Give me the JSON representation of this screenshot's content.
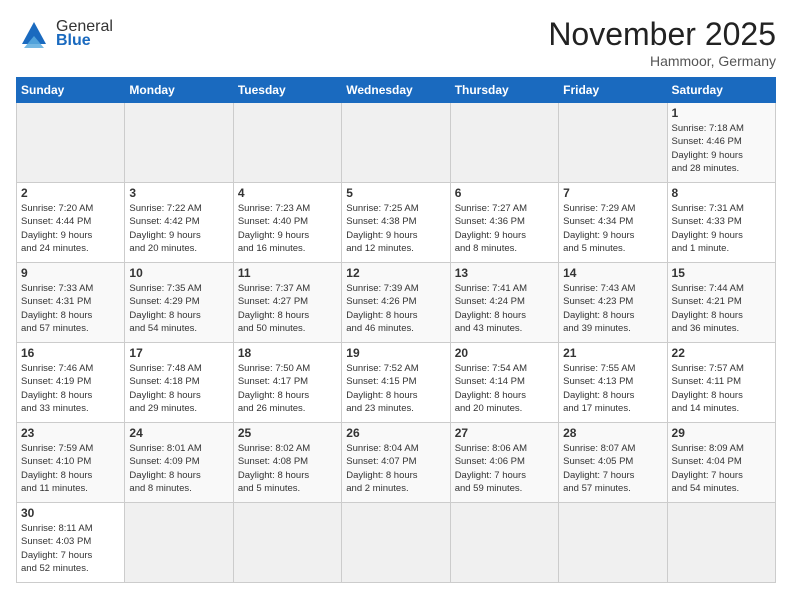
{
  "logo": {
    "general": "General",
    "blue": "Blue"
  },
  "header": {
    "title": "November 2025",
    "location": "Hammoor, Germany"
  },
  "weekdays": [
    "Sunday",
    "Monday",
    "Tuesday",
    "Wednesday",
    "Thursday",
    "Friday",
    "Saturday"
  ],
  "weeks": [
    [
      {
        "day": "",
        "info": ""
      },
      {
        "day": "",
        "info": ""
      },
      {
        "day": "",
        "info": ""
      },
      {
        "day": "",
        "info": ""
      },
      {
        "day": "",
        "info": ""
      },
      {
        "day": "",
        "info": ""
      },
      {
        "day": "1",
        "info": "Sunrise: 7:18 AM\nSunset: 4:46 PM\nDaylight: 9 hours\nand 28 minutes."
      }
    ],
    [
      {
        "day": "2",
        "info": "Sunrise: 7:20 AM\nSunset: 4:44 PM\nDaylight: 9 hours\nand 24 minutes."
      },
      {
        "day": "3",
        "info": "Sunrise: 7:22 AM\nSunset: 4:42 PM\nDaylight: 9 hours\nand 20 minutes."
      },
      {
        "day": "4",
        "info": "Sunrise: 7:23 AM\nSunset: 4:40 PM\nDaylight: 9 hours\nand 16 minutes."
      },
      {
        "day": "5",
        "info": "Sunrise: 7:25 AM\nSunset: 4:38 PM\nDaylight: 9 hours\nand 12 minutes."
      },
      {
        "day": "6",
        "info": "Sunrise: 7:27 AM\nSunset: 4:36 PM\nDaylight: 9 hours\nand 8 minutes."
      },
      {
        "day": "7",
        "info": "Sunrise: 7:29 AM\nSunset: 4:34 PM\nDaylight: 9 hours\nand 5 minutes."
      },
      {
        "day": "8",
        "info": "Sunrise: 7:31 AM\nSunset: 4:33 PM\nDaylight: 9 hours\nand 1 minute."
      }
    ],
    [
      {
        "day": "9",
        "info": "Sunrise: 7:33 AM\nSunset: 4:31 PM\nDaylight: 8 hours\nand 57 minutes."
      },
      {
        "day": "10",
        "info": "Sunrise: 7:35 AM\nSunset: 4:29 PM\nDaylight: 8 hours\nand 54 minutes."
      },
      {
        "day": "11",
        "info": "Sunrise: 7:37 AM\nSunset: 4:27 PM\nDaylight: 8 hours\nand 50 minutes."
      },
      {
        "day": "12",
        "info": "Sunrise: 7:39 AM\nSunset: 4:26 PM\nDaylight: 8 hours\nand 46 minutes."
      },
      {
        "day": "13",
        "info": "Sunrise: 7:41 AM\nSunset: 4:24 PM\nDaylight: 8 hours\nand 43 minutes."
      },
      {
        "day": "14",
        "info": "Sunrise: 7:43 AM\nSunset: 4:23 PM\nDaylight: 8 hours\nand 39 minutes."
      },
      {
        "day": "15",
        "info": "Sunrise: 7:44 AM\nSunset: 4:21 PM\nDaylight: 8 hours\nand 36 minutes."
      }
    ],
    [
      {
        "day": "16",
        "info": "Sunrise: 7:46 AM\nSunset: 4:19 PM\nDaylight: 8 hours\nand 33 minutes."
      },
      {
        "day": "17",
        "info": "Sunrise: 7:48 AM\nSunset: 4:18 PM\nDaylight: 8 hours\nand 29 minutes."
      },
      {
        "day": "18",
        "info": "Sunrise: 7:50 AM\nSunset: 4:17 PM\nDaylight: 8 hours\nand 26 minutes."
      },
      {
        "day": "19",
        "info": "Sunrise: 7:52 AM\nSunset: 4:15 PM\nDaylight: 8 hours\nand 23 minutes."
      },
      {
        "day": "20",
        "info": "Sunrise: 7:54 AM\nSunset: 4:14 PM\nDaylight: 8 hours\nand 20 minutes."
      },
      {
        "day": "21",
        "info": "Sunrise: 7:55 AM\nSunset: 4:13 PM\nDaylight: 8 hours\nand 17 minutes."
      },
      {
        "day": "22",
        "info": "Sunrise: 7:57 AM\nSunset: 4:11 PM\nDaylight: 8 hours\nand 14 minutes."
      }
    ],
    [
      {
        "day": "23",
        "info": "Sunrise: 7:59 AM\nSunset: 4:10 PM\nDaylight: 8 hours\nand 11 minutes."
      },
      {
        "day": "24",
        "info": "Sunrise: 8:01 AM\nSunset: 4:09 PM\nDaylight: 8 hours\nand 8 minutes."
      },
      {
        "day": "25",
        "info": "Sunrise: 8:02 AM\nSunset: 4:08 PM\nDaylight: 8 hours\nand 5 minutes."
      },
      {
        "day": "26",
        "info": "Sunrise: 8:04 AM\nSunset: 4:07 PM\nDaylight: 8 hours\nand 2 minutes."
      },
      {
        "day": "27",
        "info": "Sunrise: 8:06 AM\nSunset: 4:06 PM\nDaylight: 7 hours\nand 59 minutes."
      },
      {
        "day": "28",
        "info": "Sunrise: 8:07 AM\nSunset: 4:05 PM\nDaylight: 7 hours\nand 57 minutes."
      },
      {
        "day": "29",
        "info": "Sunrise: 8:09 AM\nSunset: 4:04 PM\nDaylight: 7 hours\nand 54 minutes."
      }
    ],
    [
      {
        "day": "30",
        "info": "Sunrise: 8:11 AM\nSunset: 4:03 PM\nDaylight: 7 hours\nand 52 minutes."
      },
      {
        "day": "",
        "info": ""
      },
      {
        "day": "",
        "info": ""
      },
      {
        "day": "",
        "info": ""
      },
      {
        "day": "",
        "info": ""
      },
      {
        "day": "",
        "info": ""
      },
      {
        "day": "",
        "info": ""
      }
    ]
  ]
}
